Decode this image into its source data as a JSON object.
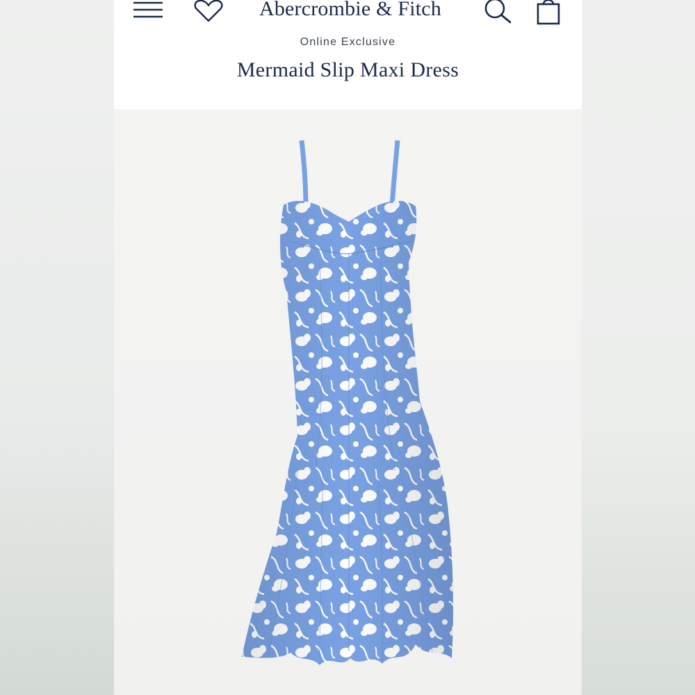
{
  "header": {
    "brand": "Abercrombie & Fitch",
    "icons": {
      "menu": "hamburger-menu-icon",
      "wishlist": "heart-icon",
      "search": "search-icon",
      "bag": "shopping-bag-icon"
    },
    "colors": {
      "brand_navy": "#1b2a48"
    }
  },
  "product": {
    "badge": "Online Exclusive",
    "title": "Mermaid Slip Maxi Dress",
    "image": {
      "subject": "product-photo",
      "print_colors": [
        "#7aa2e3",
        "#ffffff"
      ]
    }
  }
}
